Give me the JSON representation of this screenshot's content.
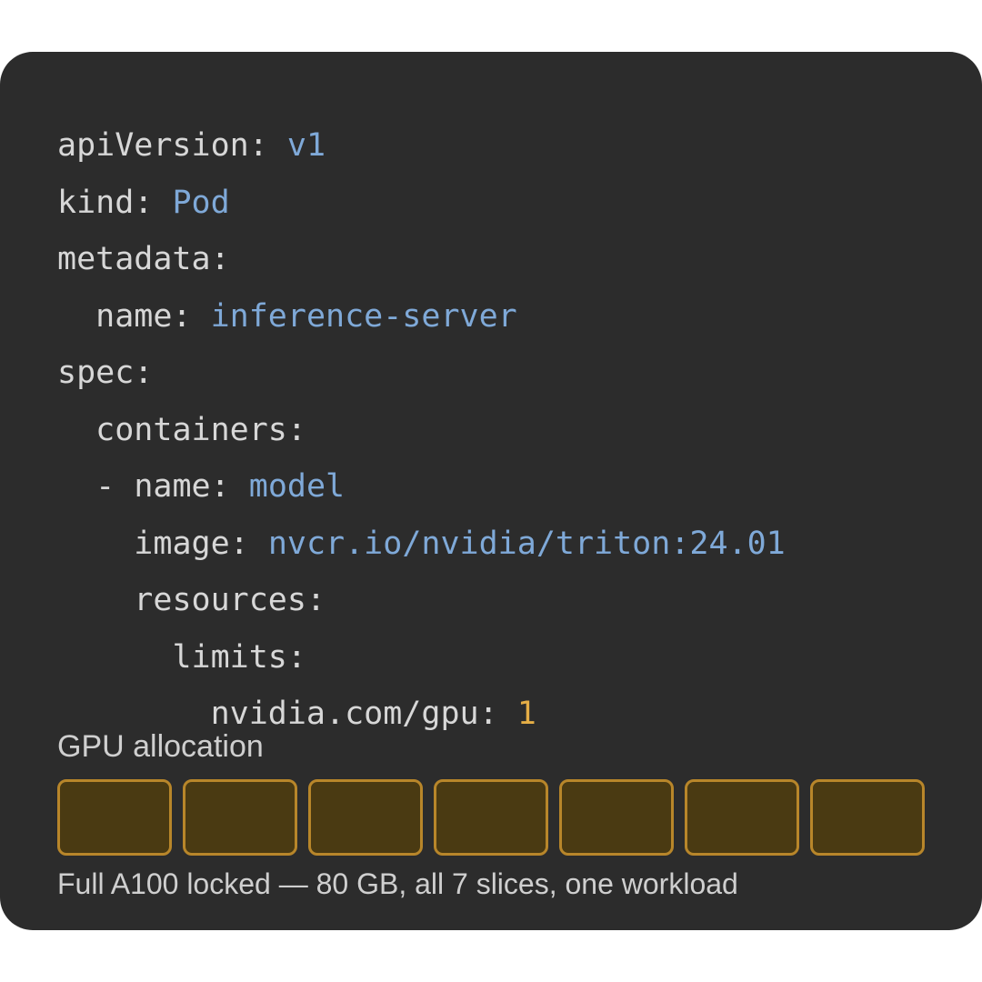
{
  "colors": {
    "page_background": "#ffffff",
    "card_background": "#2c2c2c",
    "key_text": "#d7d7d7",
    "string_value": "#7fa9d8",
    "number_value": "#e5ae46",
    "slice_border": "#b8862a",
    "slice_fill": "#4a3a12"
  },
  "yaml": {
    "apiVersion_key": "apiVersion: ",
    "apiVersion_value": "v1",
    "kind_key": "kind: ",
    "kind_value": "Pod",
    "metadata_key": "metadata:",
    "metadata_name_indent": "  ",
    "metadata_name_key": "name: ",
    "metadata_name_value": "inference-server",
    "spec_key": "spec:",
    "containers_indent": "  ",
    "containers_key": "containers:",
    "container_item_indent": "  ",
    "container_dash": "- ",
    "container_name_key": "name: ",
    "container_name_value": "model",
    "image_indent": "    ",
    "image_key": "image: ",
    "image_value": "nvcr.io/nvidia/triton:24.01",
    "resources_indent": "    ",
    "resources_key": "resources:",
    "limits_indent": "      ",
    "limits_key": "limits:",
    "gpu_indent": "        ",
    "gpu_key": "nvidia.com/gpu: ",
    "gpu_value": "1"
  },
  "gpu_allocation": {
    "label": "GPU allocation",
    "slices_total": 7,
    "slices_allocated": 7,
    "caption": "Full A100 locked — 80 GB, all 7 slices, one workload"
  }
}
